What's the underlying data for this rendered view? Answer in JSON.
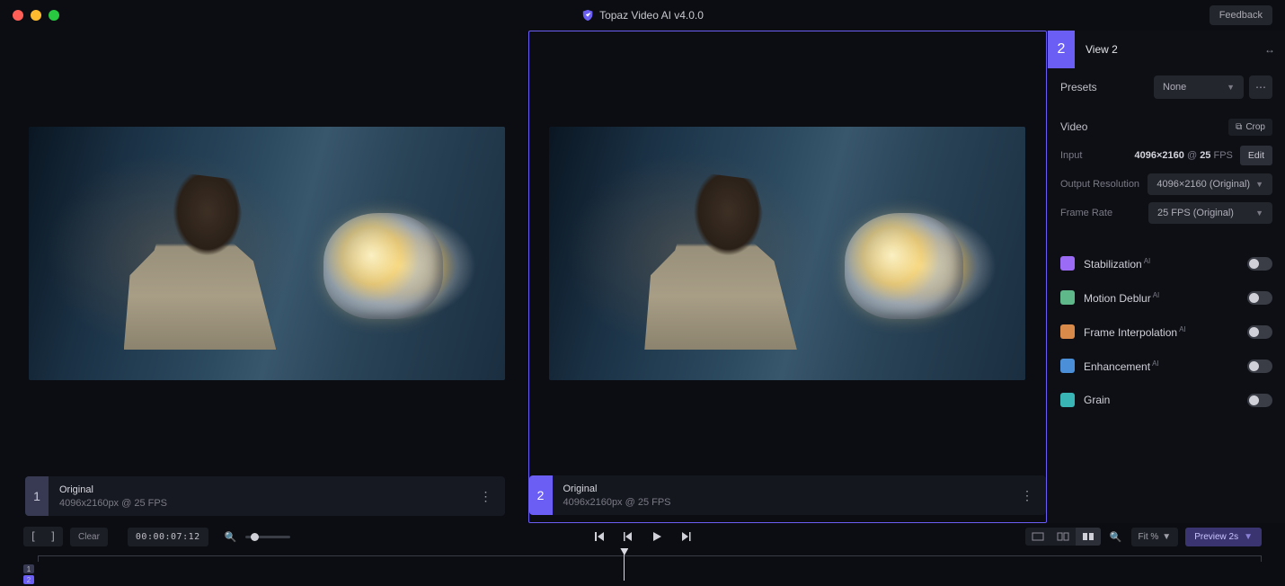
{
  "app": {
    "title": "Topaz Video AI  v4.0.0",
    "feedback_label": "Feedback"
  },
  "views": [
    {
      "index": "1",
      "title": "Original",
      "meta": "4096x2160px @ 25 FPS"
    },
    {
      "index": "2",
      "title": "Original",
      "meta": "4096x2160px @ 25 FPS"
    }
  ],
  "sidebar": {
    "index": "2",
    "view_title": "View 2",
    "presets_label": "Presets",
    "presets_value": "None",
    "video_label": "Video",
    "crop_label": "Crop",
    "input_label": "Input",
    "input_value_res": "4096×2160",
    "input_value_at": "@",
    "input_value_fps": "25",
    "input_value_fps_label": "FPS",
    "edit_label": "Edit",
    "output_res_label": "Output Resolution",
    "output_res_value": "4096×2160 (Original)",
    "frame_rate_label": "Frame Rate",
    "frame_rate_value": "25 FPS (Original)",
    "effects": [
      {
        "name": "Stabilization",
        "sup": "AI",
        "color": "#9b6bf5"
      },
      {
        "name": "Motion Deblur",
        "sup": "AI",
        "color": "#5fb88a"
      },
      {
        "name": "Frame Interpolation",
        "sup": "AI",
        "color": "#d88a4a"
      },
      {
        "name": "Enhancement",
        "sup": "AI",
        "color": "#4a8fd8"
      },
      {
        "name": "Grain",
        "sup": "",
        "color": "#3ab5b5"
      }
    ]
  },
  "timeline": {
    "bracket_in": "[",
    "bracket_out": "]",
    "clear_label": "Clear",
    "timecode": "00:00:07:12",
    "fit_label": "Fit %",
    "preview_label": "Preview 2s",
    "tracks": [
      "1",
      "2"
    ]
  }
}
